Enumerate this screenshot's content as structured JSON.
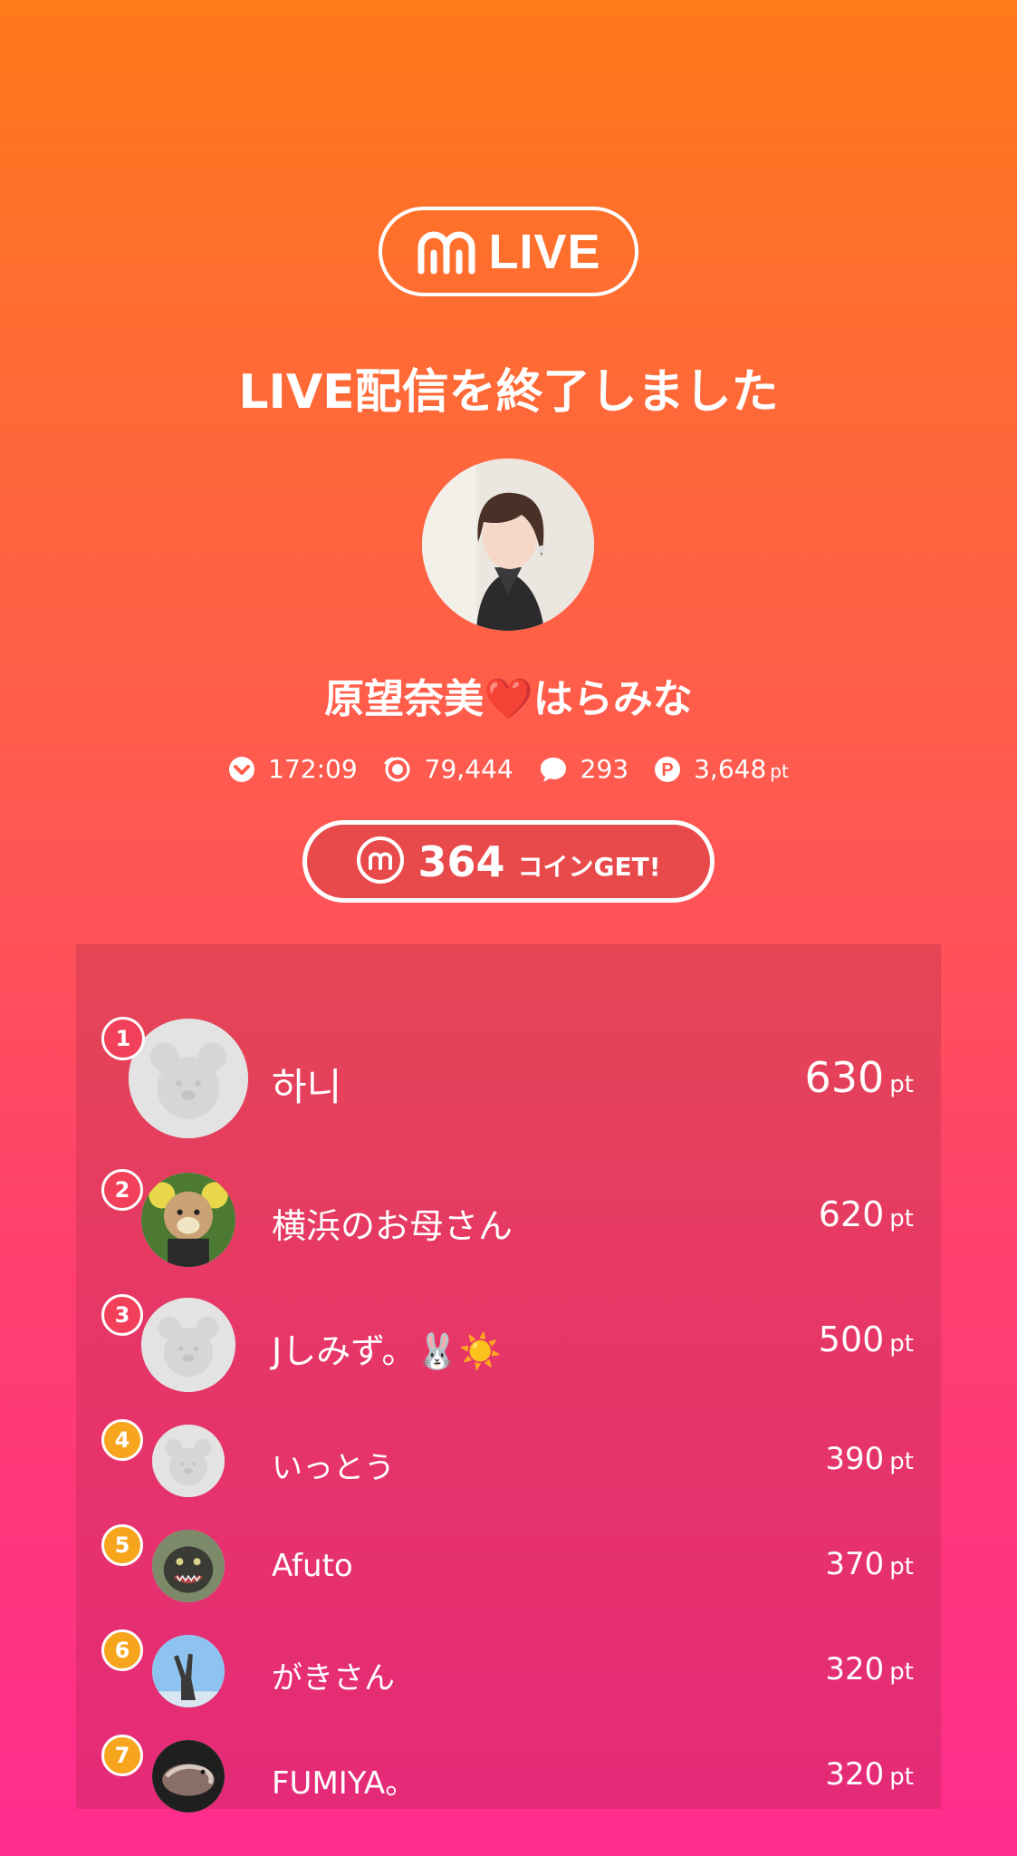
{
  "brand": {
    "logo_text": "LIVE"
  },
  "title": "LIVE配信を終了しました",
  "user": {
    "name_before": "原望奈美",
    "heart": "❤️",
    "name_after": "はらみな"
  },
  "stats": {
    "duration": "172:09",
    "viewers": "79,444",
    "comments": "293",
    "points": "3,648",
    "points_unit": "pt"
  },
  "coin": {
    "amount": "364",
    "label": "コインGET!"
  },
  "ranking": [
    {
      "rank": "1",
      "name": "하니",
      "points": "630",
      "unit": "pt",
      "avatar": "default-bear"
    },
    {
      "rank": "2",
      "name": "横浜のお母さん",
      "points": "620",
      "unit": "pt",
      "avatar": "bear-plush-photo"
    },
    {
      "rank": "3",
      "name": "Jしみず。🐰☀️",
      "points": "500",
      "unit": "pt",
      "avatar": "default-bear"
    },
    {
      "rank": "4",
      "name": "いっとう",
      "points": "390",
      "unit": "pt",
      "avatar": "default-bear"
    },
    {
      "rank": "5",
      "name": "Afuto",
      "points": "370",
      "unit": "pt",
      "avatar": "godzilla-photo"
    },
    {
      "rank": "6",
      "name": "がきさん",
      "points": "320",
      "unit": "pt",
      "avatar": "peace-sign-photo"
    },
    {
      "rank": "7",
      "name": "FUMIYA。",
      "points": "320",
      "unit": "pt",
      "avatar": "bird-photo"
    }
  ]
}
